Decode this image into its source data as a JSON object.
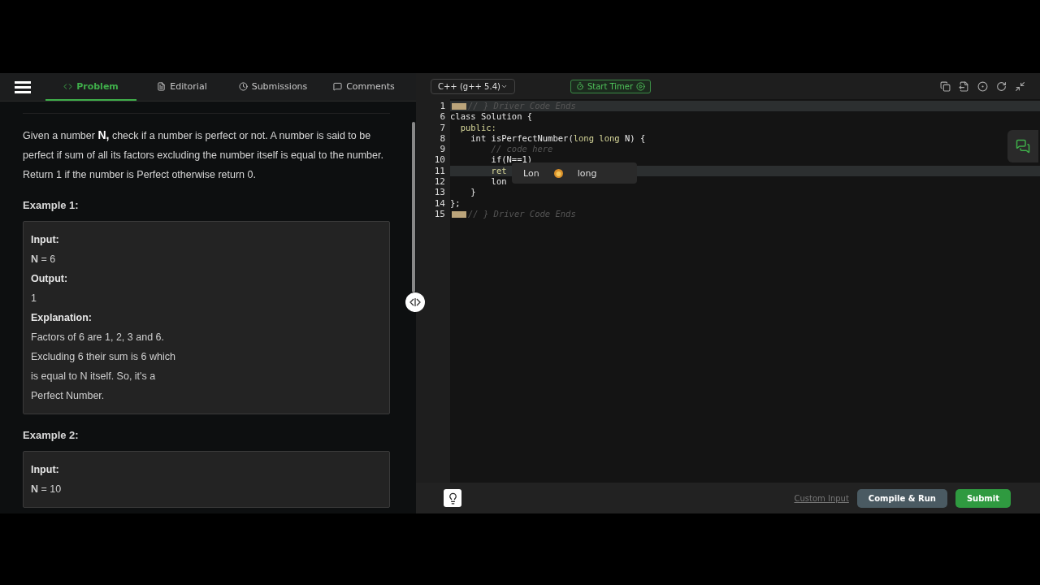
{
  "tabs": [
    {
      "label": "Problem",
      "selected": true
    },
    {
      "label": "Editorial",
      "selected": false
    },
    {
      "label": "Submissions",
      "selected": false
    },
    {
      "label": "Comments",
      "selected": false
    }
  ],
  "problem": {
    "statement": "Given a number **N,** check if a number is perfect or not. A number is said to be perfect if sum of all its factors excluding the number itself is equal to the number. Return 1 if the number is Perfect otherwise return 0.",
    "examples": [
      {
        "title": "Example 1:",
        "lines": [
          {
            "kind": "label",
            "text": "Input:"
          },
          {
            "kind": "value",
            "text": "**N** = 6"
          },
          {
            "kind": "label",
            "text": "Output:"
          },
          {
            "kind": "value",
            "text": "1"
          },
          {
            "kind": "label",
            "text": "Explanation:"
          },
          {
            "kind": "value",
            "text": "Factors of 6 are 1, 2, 3 and 6."
          },
          {
            "kind": "value",
            "text": "Excluding 6 their sum is 6 which"
          },
          {
            "kind": "value",
            "text": "is equal to N itself. So, it's a"
          },
          {
            "kind": "value",
            "text": "Perfect Number."
          }
        ]
      },
      {
        "title": "Example 2:",
        "lines": [
          {
            "kind": "label",
            "text": "Input:"
          },
          {
            "kind": "value",
            "text": "**N** = 10"
          }
        ]
      }
    ]
  },
  "editor": {
    "language": "C++ (g++ 5.4)",
    "timer_button": "Start Timer",
    "lines": [
      {
        "number": "1",
        "folded": true,
        "highlighted": true,
        "segments": [
          {
            "kind": "comment",
            "text": "// } Driver Code Ends"
          }
        ]
      },
      {
        "number": "6",
        "folded": false,
        "highlighted": false,
        "segments": [
          {
            "kind": "plain",
            "text": "class Solution {"
          }
        ]
      },
      {
        "number": "7",
        "folded": false,
        "highlighted": false,
        "segments": [
          {
            "kind": "keyword",
            "text": "  public:"
          }
        ]
      },
      {
        "number": "8",
        "folded": false,
        "highlighted": false,
        "segments": [
          {
            "kind": "plain",
            "text": "    int isPerfectNumber("
          },
          {
            "kind": "keyword",
            "text": "long long"
          },
          {
            "kind": "plain",
            "text": " N) {"
          }
        ]
      },
      {
        "number": "9",
        "folded": false,
        "highlighted": false,
        "segments": [
          {
            "kind": "comment",
            "text": "        // code here"
          }
        ]
      },
      {
        "number": "10",
        "folded": false,
        "highlighted": false,
        "segments": [
          {
            "kind": "plain",
            "text": "        if(N==1)"
          }
        ]
      },
      {
        "number": "11",
        "folded": false,
        "highlighted": true,
        "segments": [
          {
            "kind": "keyword",
            "text": "        ret"
          }
        ]
      },
      {
        "number": "12",
        "folded": false,
        "highlighted": false,
        "segments": [
          {
            "kind": "plain",
            "text": "        lon"
          }
        ]
      },
      {
        "number": "13",
        "folded": false,
        "highlighted": false,
        "segments": [
          {
            "kind": "plain",
            "text": "    }"
          }
        ]
      },
      {
        "number": "14",
        "folded": false,
        "highlighted": false,
        "segments": [
          {
            "kind": "plain",
            "text": "};"
          }
        ]
      },
      {
        "number": "15",
        "folded": true,
        "highlighted": false,
        "segments": [
          {
            "kind": "comment",
            "text": "// } Driver Code Ends"
          }
        ]
      }
    ],
    "suggestion": {
      "typed": "Lon",
      "completion": "long"
    },
    "custom_input": "Custom Input",
    "compile_button": "Compile & Run",
    "submit_button": "Submit"
  }
}
